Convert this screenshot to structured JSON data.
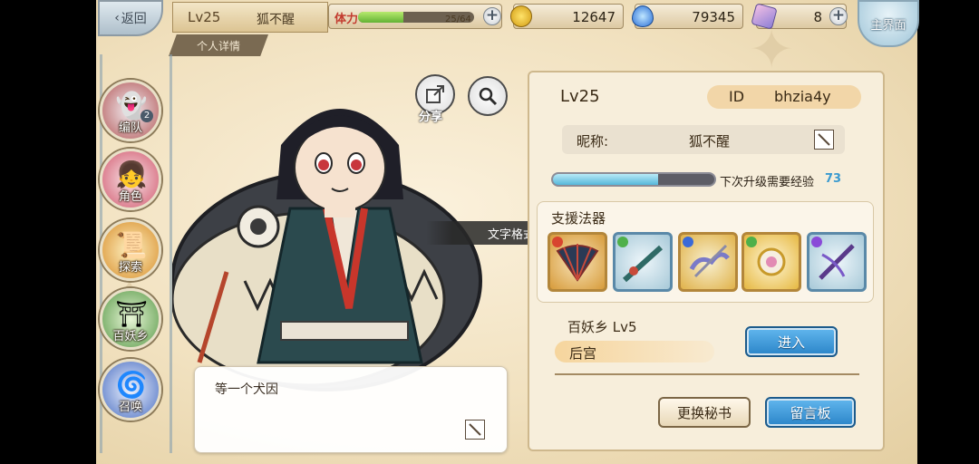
{
  "topbar": {
    "back_label": "返回",
    "level": "Lv25",
    "player_name": "狐不醒",
    "detail_tab": "个人详情",
    "stamina_label": "体力",
    "stamina_value": "25/64",
    "stamina_fraction": 0.39,
    "gold": "12647",
    "soul": "79345",
    "crystal": "8",
    "main_label": "主界面"
  },
  "menu": [
    {
      "label": "编队",
      "badge": "2",
      "icon": "ghost-icon"
    },
    {
      "label": "角色",
      "icon": "character-icon"
    },
    {
      "label": "探索",
      "icon": "scroll-icon"
    },
    {
      "label": "百妖乡",
      "icon": "pavilion-icon"
    },
    {
      "label": "召唤",
      "icon": "summon-swirl-icon"
    }
  ],
  "character": {
    "share_label": "分享",
    "tooltip": "文字格式语法错误",
    "message": "等一个犬因"
  },
  "profile": {
    "level": "Lv25",
    "id_label": "ID",
    "id_value": "bhzia4y",
    "nick_label": "昵称:",
    "nick_value": "狐不醒",
    "exp_label": "下次升级需要经验",
    "exp_value": "73",
    "exp_fraction": 0.65,
    "support_title": "支援法器",
    "relics": [
      {
        "name": "folding-fan-relic",
        "frame": "gold"
      },
      {
        "name": "sword-relic",
        "frame": "blue"
      },
      {
        "name": "cloud-blade-relic",
        "frame": "gold"
      },
      {
        "name": "orb-relic",
        "frame": "gold"
      },
      {
        "name": "crossbow-relic",
        "frame": "blue"
      }
    ],
    "village": "百妖乡  Lv5",
    "harem": "后宫",
    "enter_label": "进入",
    "secretary_label": "更换秘书",
    "board_label": "留言板"
  },
  "colors": {
    "panel_bg": "#f7eedb",
    "accent_blue": "#2a84c8",
    "stamina_green": "#62b234"
  }
}
